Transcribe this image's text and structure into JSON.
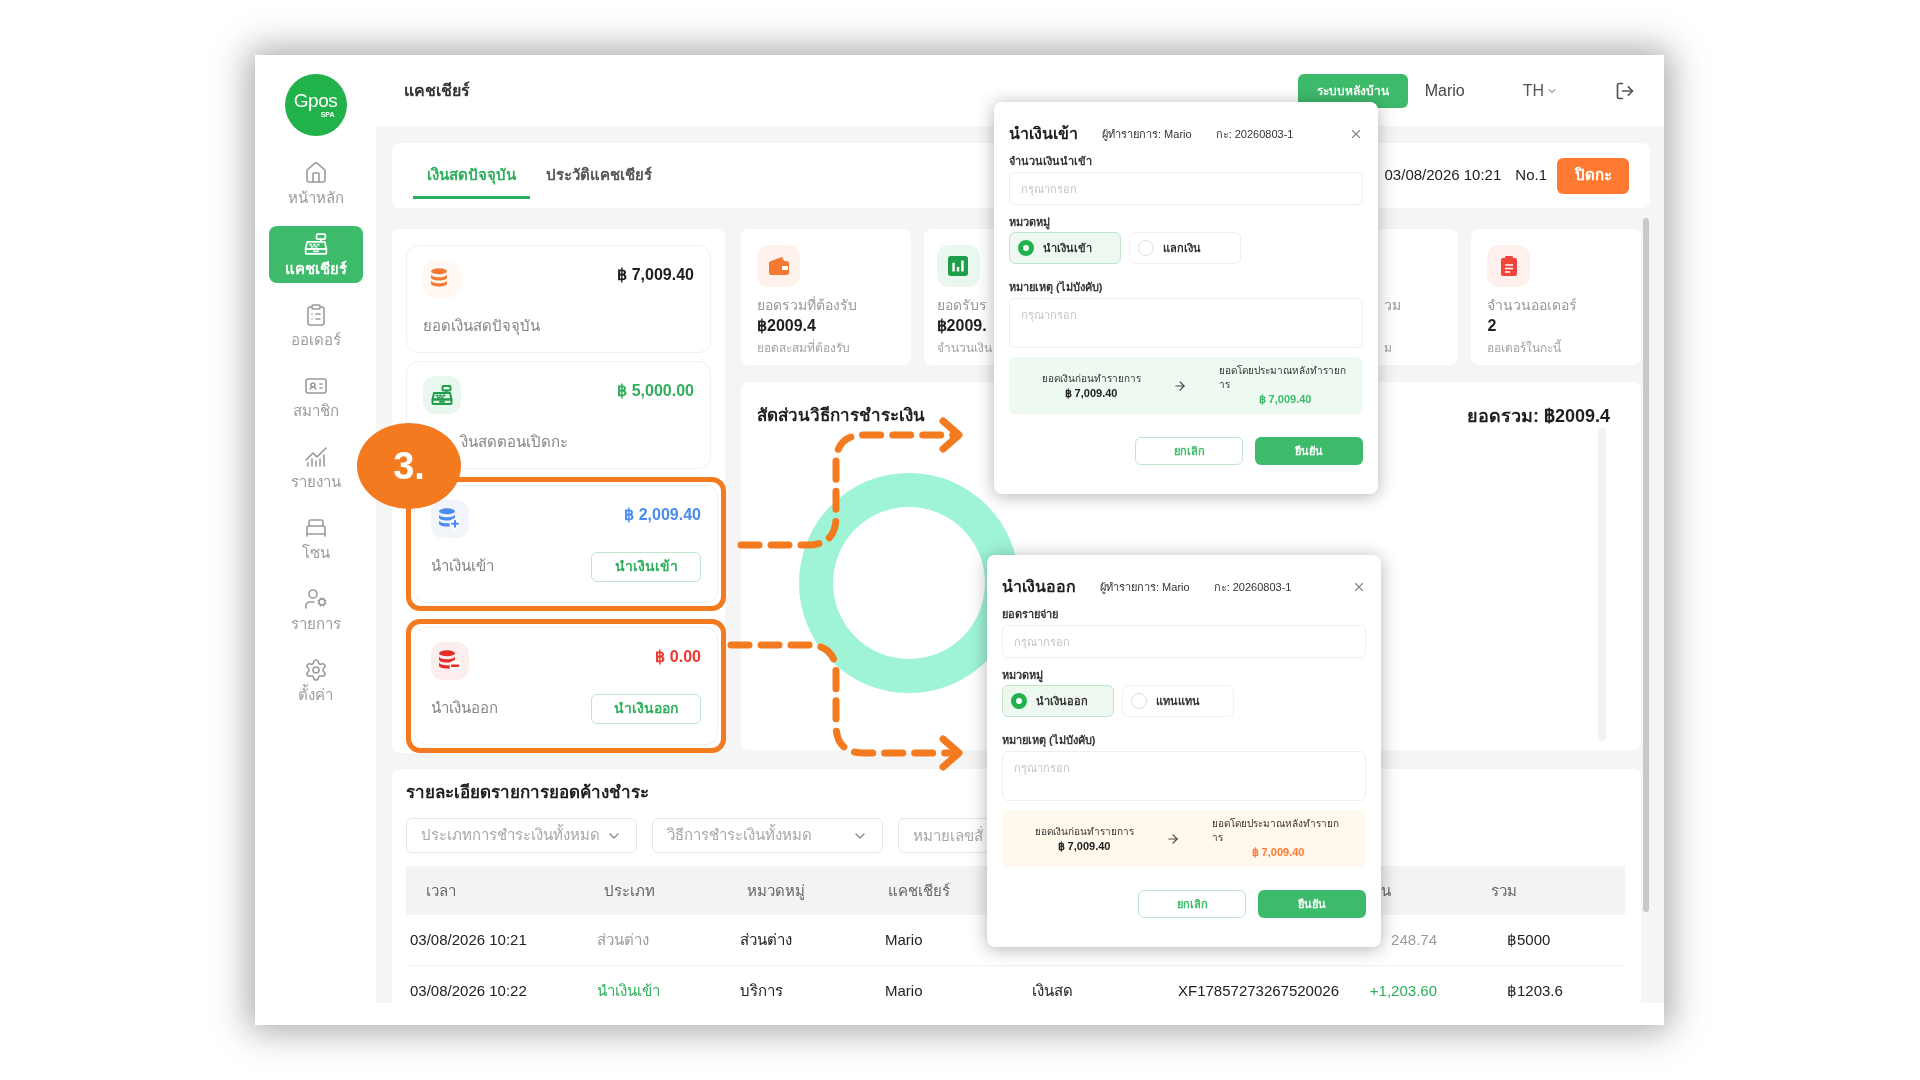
{
  "sidebar": {
    "logo": {
      "text": "Gpos",
      "subtext": "SPA"
    },
    "items": [
      {
        "kind": "home",
        "label": "หน้าหลัก",
        "selected": false
      },
      {
        "kind": "cashier",
        "label": "แคชเชียร์",
        "selected": true
      },
      {
        "kind": "orders",
        "label": "ออเดอร์",
        "selected": false
      },
      {
        "kind": "members",
        "label": "สมาชิก",
        "selected": false
      },
      {
        "kind": "reports",
        "label": "รายงาน",
        "selected": false
      },
      {
        "kind": "zones",
        "label": "โซน",
        "selected": false
      },
      {
        "kind": "services",
        "label": "รายการ",
        "selected": false
      },
      {
        "kind": "settings",
        "label": "ตั้งค่า",
        "selected": false
      }
    ]
  },
  "top_bar": {
    "title": "แคชเชียร์",
    "backoffice_button": "ระบบหลังบ้าน",
    "user": "Mario",
    "language": "TH"
  },
  "tabs": [
    {
      "label": "เงินสดปัจจุบัน",
      "selected": true
    },
    {
      "label": "ประวัติแคชเชียร์",
      "selected": false
    }
  ],
  "shift": {
    "opened_at": "03/08/2026 10:21",
    "number": "No.1",
    "close_button": "ปิดกะ"
  },
  "cash_cards": [
    {
      "kind": "current",
      "amount": "฿ 7,009.40",
      "label": "ยอดเงินสดปัจจุบัน",
      "highlighted": false
    },
    {
      "kind": "opening",
      "amount": "฿ 5,000.00",
      "label": "งินสดตอนเปิดกะ",
      "highlighted": false,
      "step_badge": "3."
    },
    {
      "kind": "cash_in",
      "amount": "฿ 2,009.40",
      "label": "นำเงินเข้า",
      "button": "นำเงินเข้า",
      "highlighted": true
    },
    {
      "kind": "cash_out",
      "amount": "฿ 0.00",
      "label": "นำเงินออก",
      "button": "นำเงินออก",
      "highlighted": true
    }
  ],
  "stats": [
    {
      "kind": "wallet",
      "label": "ยอดรวมที่ต้องรับ",
      "value": "฿2009.4",
      "note": "ยอดสะสมที่ต้องรับ"
    },
    {
      "kind": "chart",
      "label": "ยอดรับร",
      "value": "฿2009.",
      "note": "จำนวนเงิน"
    },
    {
      "kind": "partial",
      "label": "วม",
      "note": "ม"
    },
    {
      "kind": "clipboard",
      "label": "จำนวนออเดอร์",
      "value": "2",
      "note": "ออเดอร์ในกะนี้"
    }
  ],
  "payment_chart": {
    "title": "สัดส่วนวิธีการชำระเงิน",
    "total": "ยอดรวม: ฿2009.4"
  },
  "outstanding": {
    "title": "รายละเอียดรายการยอดค้างชำระ",
    "filters": [
      {
        "kind": "select",
        "placeholder": "ประเภทการชำระเงินทั้งหมด"
      },
      {
        "kind": "select",
        "placeholder": "วิธีการชำระเงินทั้งหมด"
      },
      {
        "kind": "input",
        "placeholder": "หมายเลขสั่"
      }
    ],
    "header": {
      "time": "เวลา",
      "type": "ประเภท",
      "category": "หมวดหมู่",
      "cashier": "แคชเชียร์",
      "column_7": "น",
      "total": "รวม"
    },
    "rows": [
      {
        "kind": "adjustment",
        "time": "03/08/2026 10:21",
        "type": "ส่วนต่าง",
        "category": "ส่วนต่าง",
        "cashier": "Mario",
        "column_7": "248.74",
        "total": "฿5000"
      },
      {
        "kind": "cash_in",
        "time": "03/08/2026 10:22",
        "type": "นำเงินเข้า",
        "category": "บริการ",
        "cashier": "Mario",
        "column_5": "เงินสด",
        "column_6": "XF17857273267520026",
        "column_7": "+1,203.60",
        "total": "฿1203.6"
      }
    ]
  },
  "modals": [
    {
      "kind": "cash_in",
      "title": "นำเงินเข้า",
      "operator": "ผู้ทำรายการ: Mario",
      "shift": "กะ: 20260803-1",
      "amount_field": {
        "label": "จำนวนเงินนำเข้า",
        "placeholder": "กรุณากรอก"
      },
      "category_label": "หมวดหมู่",
      "categories": [
        {
          "label": "นำเงินเข้า",
          "selected": true
        },
        {
          "label": "แลกเงิน",
          "selected": false
        }
      ],
      "note_field": {
        "label": "หมายเหตุ (ไม่บังคับ)",
        "placeholder": "กรุณากรอก"
      },
      "before_label": "ยอดเงินก่อนทำรายการ",
      "before_amount": "฿ 7,009.40",
      "after_label": "ยอดโดยประมาณหลังทำรายการ",
      "after_amount": "฿ 7,009.40",
      "cancel_button": "ยกเลิก",
      "confirm_button": "ยืนยัน"
    },
    {
      "kind": "cash_out",
      "title": "นำเงินออก",
      "operator": "ผู้ทำรายการ: Mario",
      "shift": "กะ: 20260803-1",
      "amount_field": {
        "label": "ยอดรายจ่าย",
        "placeholder": "กรุณากรอก"
      },
      "category_label": "หมวดหมู่",
      "categories": [
        {
          "label": "นำเงินออก",
          "selected": true
        },
        {
          "label": "แทนแทน",
          "selected": false
        }
      ],
      "note_field": {
        "label": "หมายเหตุ (ไม่บังคับ)",
        "placeholder": "กรุณากรอก"
      },
      "before_label": "ยอดเงินก่อนทำรายการ",
      "before_amount": "฿ 7,009.40",
      "after_label": "ยอดโดยประมาณหลังทำรายการ",
      "after_amount": "฿ 7,009.40",
      "cancel_button": "ยกเลิก",
      "confirm_button": "ยืนยัน"
    }
  ]
}
